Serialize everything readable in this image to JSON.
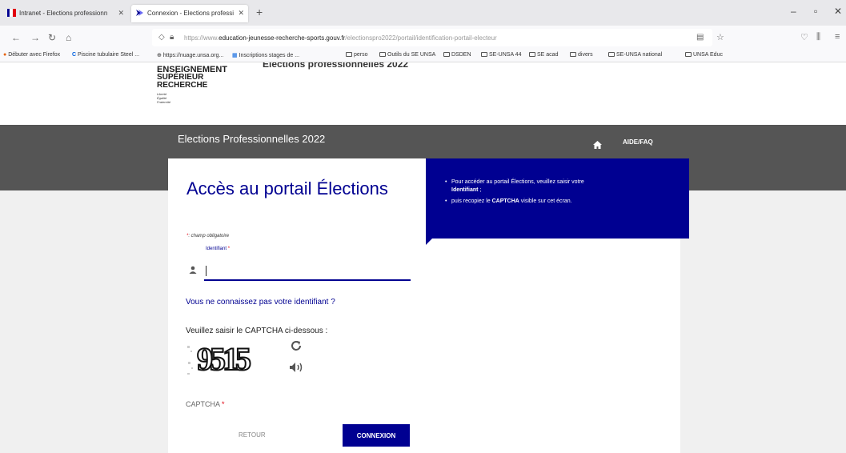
{
  "browser": {
    "tabs": [
      {
        "label": "Intranet - Elections professionn"
      },
      {
        "label": "Connexion - Elections professi"
      }
    ],
    "new_tab": "+",
    "url": {
      "prefix": "https://www.",
      "domain": "education-jeunesse-recherche-sports.gouv.fr",
      "path": "/electionspro2022/portail/identification-portail-electeur"
    },
    "bookmarks": [
      "Débuter avec Firefox",
      "Piscine tubulaire Steel ...",
      "https://nuage.unsa.org...",
      "Inscriptions stages de ...",
      "perso",
      "Outils du SE UNSA",
      "DSDEN",
      "SE-UNSA 44",
      "SE acad",
      "divers",
      "SE-UNSA national",
      "UNSA Educ"
    ]
  },
  "page": {
    "logo": [
      "ENSEIGNEMENT",
      "SUPÉRIEUR",
      "RECHERCHE"
    ],
    "motto": [
      "Liberté",
      "Égalité",
      "Fraternité"
    ],
    "cut_title": "Élections professionnelles 2022",
    "band_title": "Elections Professionnelles 2022",
    "aide": "AIDE/FAQ",
    "heading": "Accès au portail Élections",
    "required_star": "*",
    "required_text": ": champ obligatoire",
    "identifiant_label": "Identifiant",
    "forgot_link": "Vous ne connaissez pas votre identifiant ?",
    "captcha_prompt": "Veuillez saisir le CAPTCHA ci-dessous :",
    "captcha_code": "9515",
    "captcha_field_label": "CAPTCHA",
    "retour": "RETOUR",
    "connexion": "CONNEXION",
    "info": {
      "line1_a": "Pour accéder au portail Élections, veuillez saisir votre",
      "line1_b": "Identifiant",
      "line1_c": " ;",
      "line2_a": "puis recopiez le ",
      "line2_b": "CAPTCHA",
      "line2_c": " visible sur cet écran."
    }
  },
  "colors": {
    "primary": "#000091",
    "band": "#555555",
    "required": "#e1000f"
  }
}
